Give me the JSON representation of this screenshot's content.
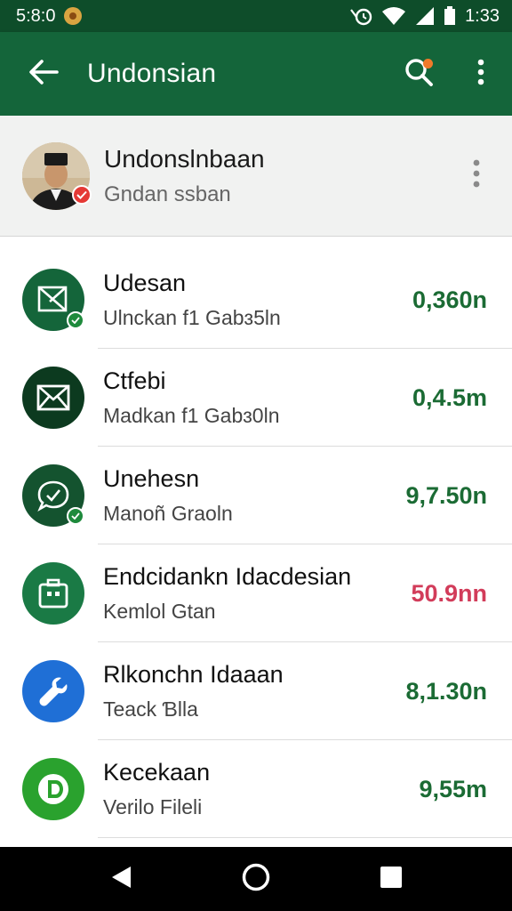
{
  "status_bar": {
    "time_left": "5:8:0",
    "time_right": "1:33",
    "icons": [
      "notification-icon",
      "alarm-icon",
      "wifi-icon",
      "signal-icon",
      "battery-icon"
    ]
  },
  "app_bar": {
    "title": "Undonsian",
    "icons": [
      "back-arrow-icon",
      "search-icon",
      "more-vert-icon"
    ]
  },
  "profile": {
    "name": "Undonslnbaan",
    "subtitle": "Gndan ssban"
  },
  "items": [
    {
      "title": "Udesan",
      "subtitle": "Ulnckan f1 Gabɜ5ln",
      "amount": "0,360n",
      "amount_color": "#1b6b34",
      "icon": "envelope-check-icon",
      "icon_bg": "#14653a",
      "badge": true
    },
    {
      "title": "Ctfebi",
      "subtitle": "Madkan f1 Gabɜ0ln",
      "amount": "0,4.5m",
      "amount_color": "#1b6b34",
      "icon": "mail-icon",
      "icon_bg": "#0c3a1f",
      "badge": false
    },
    {
      "title": "Unehesn",
      "subtitle": "Manoñ Graoln",
      "amount": "9,7.50n",
      "amount_color": "#1b6b34",
      "icon": "chat-check-icon",
      "icon_bg": "#14532f",
      "badge": true
    },
    {
      "title": "Endcidankn Idacdesian",
      "subtitle": "Kemlol Gtan",
      "amount": "50.9nn",
      "amount_color": "#d23c5a",
      "icon": "briefcase-icon",
      "icon_bg": "#1a7a45",
      "badge": false
    },
    {
      "title": "Rlkonchn Idaaan",
      "subtitle": "Teack Ɓlla",
      "amount": "8,1.30n",
      "amount_color": "#1b6b34",
      "icon": "wrench-icon",
      "icon_bg": "#1f6fd6",
      "badge": false
    },
    {
      "title": "Kecekaan",
      "subtitle": "Verilo Fileli",
      "amount": "9,55m",
      "amount_color": "#1b6b34",
      "icon": "play-d-icon",
      "icon_bg": "#2aa22e",
      "badge": false
    }
  ],
  "nav_bar": {
    "icons": [
      "back-nav-icon",
      "home-nav-icon",
      "recents-nav-icon"
    ]
  }
}
